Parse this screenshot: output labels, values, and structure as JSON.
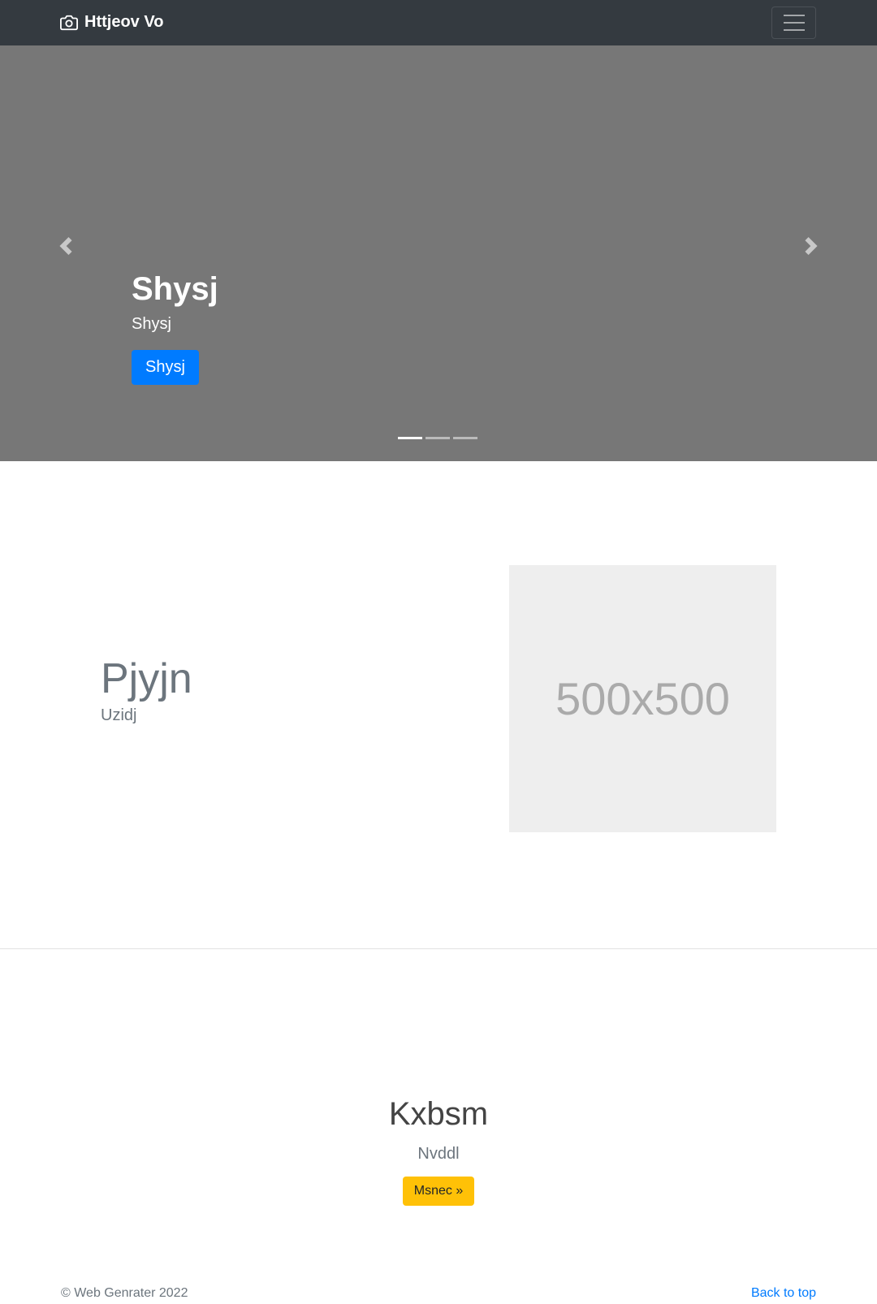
{
  "navbar": {
    "brand": "Httjeov Vo",
    "brand_icon": "camera-icon",
    "toggler_icon": "hamburger-menu-icon"
  },
  "carousel": {
    "heading": "Shysj",
    "text": "Shysj",
    "button_label": "Shysj",
    "indicators": 3,
    "active_indicator": 0,
    "prev_icon": "chevron-left-icon",
    "next_icon": "chevron-right-icon"
  },
  "featurette": {
    "heading": "Pjyjn",
    "lead": "Uzidj",
    "image_placeholder": "500x500"
  },
  "cta": {
    "heading": "Kxbsm",
    "text": "Nvddl",
    "button_label": "Msnec »"
  },
  "footer": {
    "copyright": "© Web Genrater 2022",
    "back_to_top": "Back to top"
  },
  "colors": {
    "navbar_bg": "#343a40",
    "carousel_bg": "#777777",
    "primary": "#007bff",
    "warning": "#ffc107",
    "placeholder_bg": "#eeeeee"
  }
}
